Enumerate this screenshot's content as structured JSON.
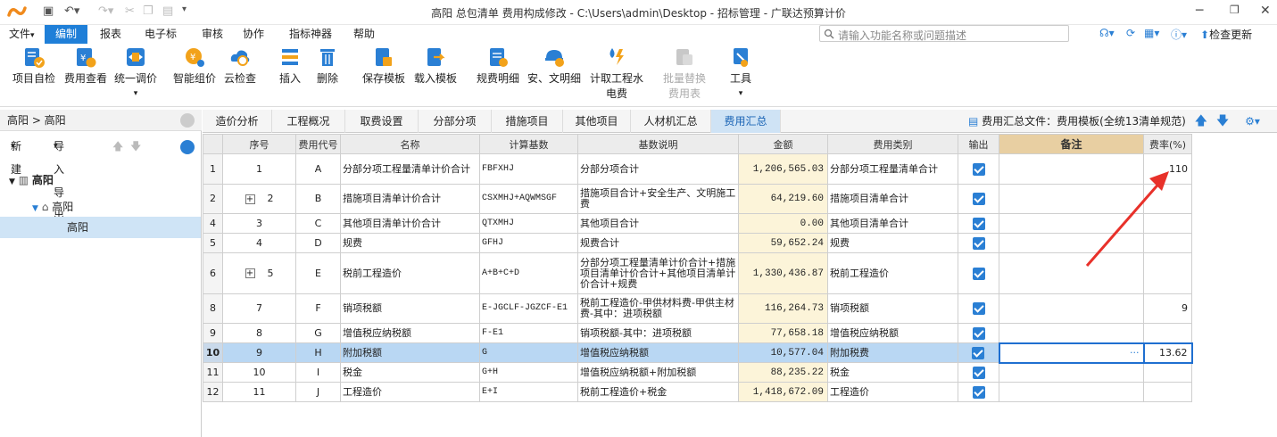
{
  "titlebar": {
    "title": "高阳 总包清单    费用构成修改 - C:\\Users\\admin\\Desktop - 招标管理 - 广联达预算计价"
  },
  "menu": {
    "items": [
      "文件",
      "编制",
      "报表",
      "电子标",
      "审核",
      "协作",
      "指标神器",
      "帮助"
    ],
    "active": "编制",
    "search_placeholder": "请输入功能名称或问题描述",
    "check_update": "检查更新"
  },
  "ribbon": {
    "buttons": [
      {
        "label": "项目自检",
        "icon": "checklist-icon"
      },
      {
        "label": "费用查看",
        "icon": "cost-view-icon"
      },
      {
        "label": "统一调价",
        "icon": "price-adjust-icon"
      },
      {
        "label": "智能组价",
        "icon": "smart-price-icon"
      },
      {
        "label": "云检查",
        "icon": "cloud-check-icon"
      },
      {
        "label": "插入",
        "icon": "insert-icon"
      },
      {
        "label": "删除",
        "icon": "trash-icon"
      },
      {
        "label": "保存模板",
        "icon": "save-template-icon"
      },
      {
        "label": "载入模板",
        "icon": "load-template-icon"
      },
      {
        "label": "规费明细",
        "icon": "fee-detail-icon"
      },
      {
        "label": "安、文明细",
        "icon": "safety-detail-icon"
      },
      {
        "label": "计取工程水",
        "label2": "电费",
        "icon": "water-electric-icon"
      },
      {
        "label": "批量替换",
        "label2": "费用表",
        "icon": "batch-replace-icon",
        "disabled": true
      },
      {
        "label": "工具",
        "icon": "tools-icon"
      }
    ]
  },
  "left": {
    "breadcrumb": "高阳 > 高阳",
    "new_label": "新建",
    "import_export_label": "导入导出",
    "tree": [
      {
        "label": "高阳",
        "level": 0
      },
      {
        "label": "高阳",
        "level": 1
      },
      {
        "label": "高阳",
        "level": 2
      }
    ]
  },
  "tabs": {
    "items": [
      "造价分析",
      "工程概况",
      "取费设置",
      "分部分项",
      "措施项目",
      "其他项目",
      "人材机汇总",
      "费用汇总"
    ],
    "active": "费用汇总",
    "file_info": "费用汇总文件：费用模板(全统13清单规范)"
  },
  "grid": {
    "headers": [
      "序号",
      "费用代号",
      "名称",
      "计算基数",
      "基数说明",
      "金额",
      "费用类别",
      "输出",
      "备注",
      "费率(%)"
    ],
    "rows": [
      {
        "idx": "1",
        "seq": "1",
        "code": "A",
        "name": "分部分项工程量清单计价合计",
        "base": "FBFXHJ",
        "desc": "分部分项合计",
        "amount": "1,206,565.03",
        "cat": "分部分项工程量清单合计",
        "out": true,
        "remark": "",
        "rate": "110",
        "expand": false
      },
      {
        "idx": "2",
        "seq": "2",
        "code": "B",
        "name": "措施项目清单计价合计",
        "base": "CSXMHJ+AQWMSGF",
        "desc": "措施项目合计+安全生产、文明施工费",
        "amount": "64,219.60",
        "cat": "措施项目清单合计",
        "out": true,
        "remark": "",
        "rate": "",
        "expand": true
      },
      {
        "idx": "4",
        "seq": "3",
        "code": "C",
        "name": "其他项目清单计价合计",
        "base": "QTXMHJ",
        "desc": "其他项目合计",
        "amount": "0.00",
        "cat": "其他项目清单合计",
        "out": true,
        "remark": "",
        "rate": "",
        "expand": false
      },
      {
        "idx": "5",
        "seq": "4",
        "code": "D",
        "name": "规费",
        "base": "GFHJ",
        "desc": "规费合计",
        "amount": "59,652.24",
        "cat": "规费",
        "out": true,
        "remark": "",
        "rate": "",
        "expand": false
      },
      {
        "idx": "6",
        "seq": "5",
        "code": "E",
        "name": "税前工程造价",
        "base": "A+B+C+D",
        "desc": "分部分项工程量清单计价合计+措施项目清单计价合计+其他项目清单计价合计+规费",
        "amount": "1,330,436.87",
        "cat": "税前工程造价",
        "out": true,
        "remark": "",
        "rate": "",
        "expand": true
      },
      {
        "idx": "8",
        "seq": "7",
        "code": "F",
        "name": "销项税额",
        "base": "E-JGCLF-JGZCF-E1",
        "desc": "税前工程造价-甲供材料费-甲供主材费-其中：进项税额",
        "amount": "116,264.73",
        "cat": "销项税额",
        "out": true,
        "remark": "",
        "rate": "9",
        "expand": false
      },
      {
        "idx": "9",
        "seq": "8",
        "code": "G",
        "name": "增值税应纳税额",
        "base": "F-E1",
        "desc": "销项税额-其中：进项税额",
        "amount": "77,658.18",
        "cat": "增值税应纳税额",
        "out": true,
        "remark": "",
        "rate": "",
        "expand": false
      },
      {
        "idx": "10",
        "seq": "9",
        "code": "H",
        "name": "附加税额",
        "base": "G",
        "desc": "增值税应纳税额",
        "amount": "10,577.04",
        "cat": "附加税费",
        "out": true,
        "remark": "···",
        "rate": "13.62",
        "expand": false,
        "selected": true
      },
      {
        "idx": "11",
        "seq": "10",
        "code": "I",
        "name": "税金",
        "base": "G+H",
        "desc": "增值税应纳税额+附加税额",
        "amount": "88,235.22",
        "cat": "税金",
        "out": true,
        "remark": "",
        "rate": "",
        "expand": false
      },
      {
        "idx": "12",
        "seq": "11",
        "code": "J",
        "name": "工程造价",
        "base": "E+I",
        "desc": "税前工程造价+税金",
        "amount": "1,418,672.09",
        "cat": "工程造价",
        "out": true,
        "remark": "",
        "rate": "",
        "expand": false
      }
    ]
  },
  "colors": {
    "accent": "#1f7fd8",
    "arrow": "#e8312a",
    "amount_bg": "#fcf4d9",
    "remark_header": "#e8cfa2"
  }
}
